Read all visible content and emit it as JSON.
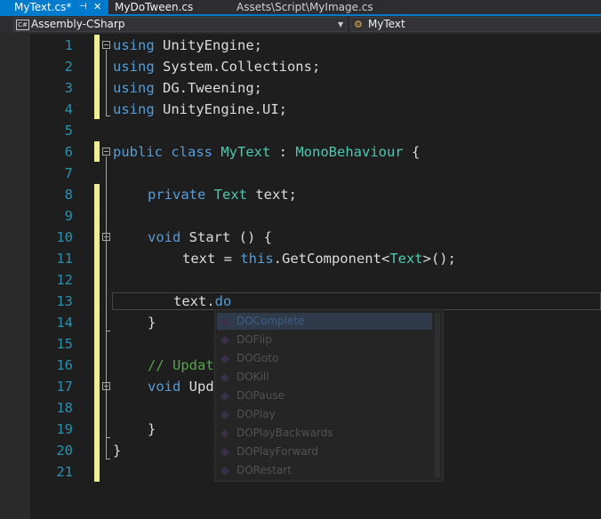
{
  "tabs": [
    {
      "label": "MyText.cs*",
      "active": true,
      "pin": "⊣",
      "close": "✕"
    },
    {
      "label": "MyDoTween.cs",
      "active": false
    },
    {
      "label": "Assets\\Script\\MyImage.cs",
      "active": false
    }
  ],
  "nav": {
    "project_icon": "C#",
    "project": "Assembly-CSharp",
    "class_icon": "class-icon",
    "class": "MyText"
  },
  "line_numbers": [
    "1",
    "2",
    "3",
    "4",
    "5",
    "6",
    "7",
    "8",
    "9",
    "10",
    "11",
    "12",
    "13",
    "14",
    "15",
    "16",
    "17",
    "18",
    "19",
    "20",
    "21"
  ],
  "code": {
    "l1": {
      "kw": "using",
      "rest": " UnityEngine;"
    },
    "l2": {
      "kw": "using",
      "rest": " System.Collections;"
    },
    "l3": {
      "kw": "using",
      "rest": " DG.Tweening;"
    },
    "l4": {
      "kw": "using",
      "rest": " UnityEngine.UI;"
    },
    "l6": {
      "kw1": "public",
      "kw2": " class ",
      "ty1": "MyText",
      "sep": " : ",
      "ty2": "MonoBehaviour",
      "end": " {"
    },
    "l8": {
      "kw": "private",
      "sp": " ",
      "ty": "Text",
      "rest": " text;"
    },
    "l10": {
      "kw": "void",
      "rest": " Start () {"
    },
    "l11": {
      "pre": "text = ",
      "kw": "this",
      "mid": ".GetComponent<",
      "ty": "Text",
      "end": ">();"
    },
    "l13": {
      "obj": "text.",
      "member": "do"
    },
    "l14": {
      "text": "}"
    },
    "l16": {
      "text": "// Update is called once per frame"
    },
    "l17": {
      "kw": "void",
      "rest": " Update () {"
    },
    "l19": {
      "text": "}"
    },
    "l20": {
      "text": "}"
    }
  },
  "suggestions": [
    "DOComplete",
    "DOFlip",
    "DOGoto",
    "DOKill",
    "DOPause",
    "DOPlay",
    "DOPlayBackwards",
    "DOPlayForward",
    "DORestart"
  ],
  "colors": {
    "keyword": "#569cd6",
    "type": "#4ec9b0",
    "comment": "#57a64a",
    "line_number": "#2b91af",
    "tab_active": "#007acc",
    "change_bar": "#efef91"
  }
}
